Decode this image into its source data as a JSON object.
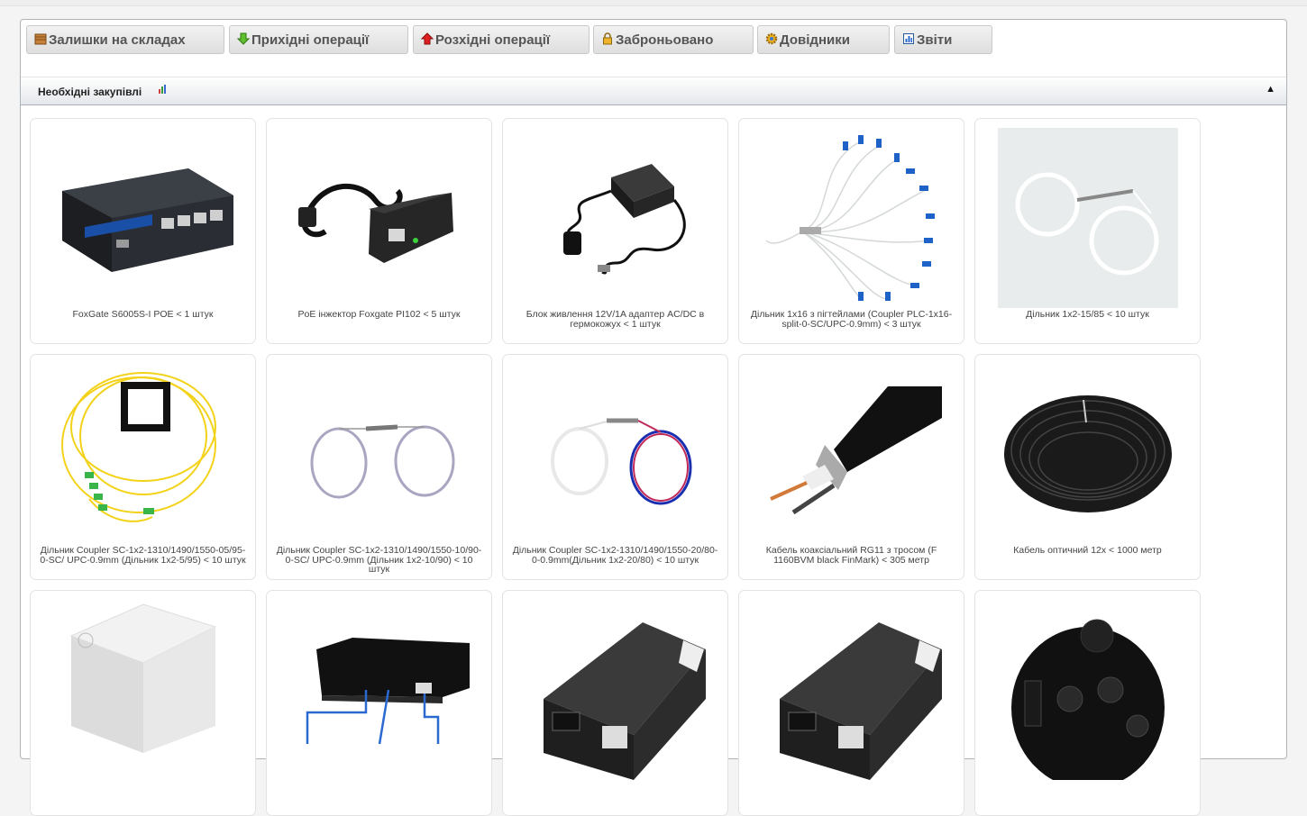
{
  "tabs": [
    {
      "label": "Залишки на складах",
      "icon": "warehouse-icon"
    },
    {
      "label": "Прихідні операції",
      "icon": "arrow-down-icon"
    },
    {
      "label": "Розхідні операції",
      "icon": "arrow-up-icon"
    },
    {
      "label": "Заброньовано",
      "icon": "lock-icon"
    },
    {
      "label": "Довідники",
      "icon": "gear-icon"
    },
    {
      "label": "Звіти",
      "icon": "report-icon"
    }
  ],
  "section": {
    "title": "Необхідні закупівлі",
    "toggle": "▲"
  },
  "products": [
    {
      "name": "FoxGate S6005S-I POE < 1 штук",
      "icon": "switch-image"
    },
    {
      "name": "PoE інжектор Foxgate PI102 < 5 штук",
      "icon": "poe-injector-image"
    },
    {
      "name": "Блок живлення 12V/1A адаптер AC/DC в гермокожух < 1 штук",
      "icon": "power-adapter-image"
    },
    {
      "name": "Дільник 1х16 з пігтейлами (Coupler PLC-1x16-split-0-SC/UPC-0.9mm) < 3 штук",
      "icon": "splitter-1x16-image"
    },
    {
      "name": "Дільник 1х2-15/85 < 10 штук",
      "icon": "splitter-1x2-image"
    },
    {
      "name": "Дільник Coupler SC-1x2-1310/1490/1550-05/95-0-SC/ UPC-0.9mm (Дільник 1х2-5/95) < 10 штук",
      "icon": "coupler-yellow-image"
    },
    {
      "name": "Дільник Coupler SC-1x2-1310/1490/1550-10/90-0-SC/ UPC-0.9mm (Дільник 1х2-10/90) < 10 штук",
      "icon": "coupler-grey-image"
    },
    {
      "name": "Дільник Coupler SC-1x2-1310/1490/1550-20/80-0-0.9mm(Дільник 1х2-20/80) < 10 штук",
      "icon": "coupler-red-blue-image"
    },
    {
      "name": "Кабель коаксіальний RG11 з тросом (F 1160BVM black FinMark) < 305 метр",
      "icon": "coax-cable-image"
    },
    {
      "name": "Кабель оптичний 12х < 1000 метр",
      "icon": "fiber-cable-image"
    },
    {
      "name": "",
      "icon": "junction-box-image"
    },
    {
      "name": "",
      "icon": "media-box-image"
    },
    {
      "name": "",
      "icon": "media-converter-image"
    },
    {
      "name": "",
      "icon": "media-converter-image"
    },
    {
      "name": "",
      "icon": "splice-closure-image"
    }
  ]
}
